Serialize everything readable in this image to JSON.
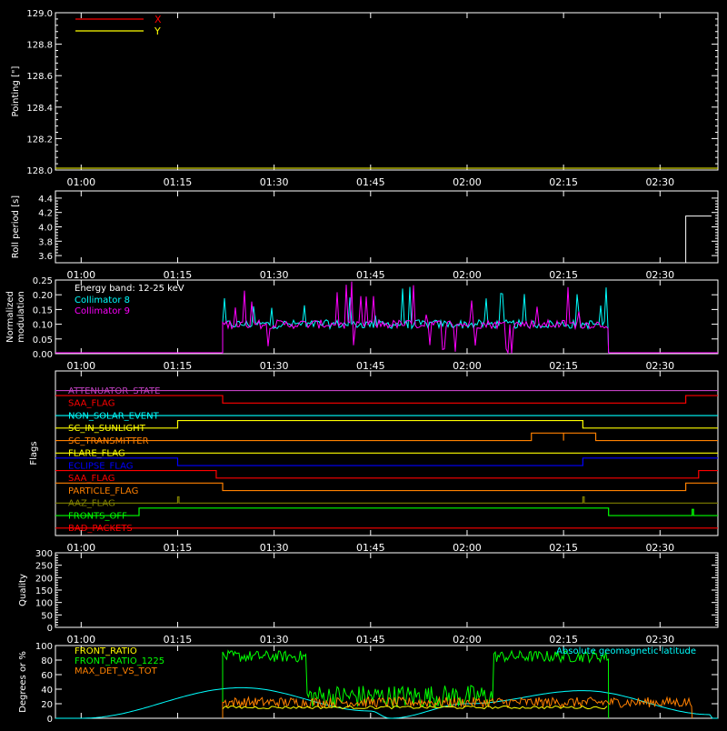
{
  "colors": {
    "background": "#000000",
    "axes": "#ffffff",
    "x": "#ff0000",
    "y": "#ffff00",
    "cyan": "#00ffff",
    "magenta": "#ff00ff",
    "green": "#00ff00",
    "orange": "#ff8000"
  },
  "time_ticks": [
    "01:00",
    "01:15",
    "01:30",
    "01:45",
    "02:00",
    "02:15",
    "02:30"
  ],
  "chart_data": [
    {
      "type": "line",
      "ylabel": "Pointing [\"]",
      "ylim": [
        128.0,
        129.0
      ],
      "yticks": [
        "128.0",
        "128.2",
        "128.4",
        "128.6",
        "128.8",
        "129.0"
      ],
      "legend_position": "top-left",
      "series": [
        {
          "name": "X",
          "color": "#ff0000",
          "x": [],
          "y": []
        },
        {
          "name": "Y",
          "color": "#ffff00",
          "x": [],
          "y": []
        }
      ]
    },
    {
      "type": "line",
      "ylabel": "Roll period [s]",
      "ylim": [
        3.5,
        4.5
      ],
      "yticks": [
        "3.6",
        "3.8",
        "4.0",
        "4.2",
        "4.4"
      ],
      "series": [
        {
          "x": [
            "02:34",
            "02:34",
            "02:38"
          ],
          "y": [
            3.5,
            4.15,
            4.15
          ]
        }
      ]
    },
    {
      "type": "line",
      "ylabel": "Normalized modulation",
      "ylim": [
        0.0,
        0.25
      ],
      "yticks": [
        "0.00",
        "0.05",
        "0.10",
        "0.15",
        "0.20",
        "0.25"
      ],
      "annotation": "Energy band: 12-25 keV",
      "legend_position": "top-left",
      "series": [
        {
          "name": "Collimator 8",
          "color": "#00ffff",
          "active_range": [
            "01:22",
            "02:22"
          ],
          "typical_value": 0.1,
          "peak_value": 0.23
        },
        {
          "name": "Collimator 9",
          "color": "#ff00ff",
          "active_range": [
            "01:22",
            "02:22"
          ],
          "typical_value": 0.1,
          "peak_value": 0.25
        }
      ]
    },
    {
      "type": "line",
      "ylabel": "Flags",
      "series": [
        {
          "name": "ATTENUATOR_STATE",
          "color": "#c040c0",
          "transitions": []
        },
        {
          "name": "SAA_FLAG_2",
          "label": "SAA_FLAG",
          "color": "#ff0000",
          "transitions": [
            [
              "01:00",
              1
            ],
            [
              "01:22",
              0
            ],
            [
              "02:34",
              1
            ]
          ]
        },
        {
          "name": "NON_SOLAR_EVENT",
          "color": "#00ffff",
          "transitions": []
        },
        {
          "name": "SC_IN_SUNLIGHT",
          "color": "#ffff00",
          "transitions": [
            [
              "01:00",
              0
            ],
            [
              "01:15",
              1
            ],
            [
              "02:18",
              0
            ]
          ]
        },
        {
          "name": "SC_TRANSMITTER",
          "color": "#ff8000",
          "transitions": [
            [
              "01:00",
              0
            ],
            [
              "02:10",
              1
            ],
            [
              "02:15",
              0
            ],
            [
              "02:15",
              1
            ],
            [
              "02:20",
              0
            ]
          ]
        },
        {
          "name": "FLARE_FLAG",
          "color": "#ffff00",
          "transitions": []
        },
        {
          "name": "ECLIPSE_FLAG",
          "color": "#0000ff",
          "transitions": [
            [
              "01:00",
              1
            ],
            [
              "01:15",
              0
            ],
            [
              "02:18",
              1
            ]
          ]
        },
        {
          "name": "SAA_FLAG",
          "color": "#ff0000",
          "transitions": [
            [
              "01:00",
              1
            ],
            [
              "01:21",
              0
            ],
            [
              "02:36",
              1
            ]
          ]
        },
        {
          "name": "PARTICLE_FLAG",
          "color": "#ff8000",
          "transitions": [
            [
              "01:00",
              1
            ],
            [
              "01:22",
              0
            ],
            [
              "02:34",
              1
            ]
          ]
        },
        {
          "name": "AAZ_FLAG",
          "color": "#808000",
          "transitions": [
            [
              "01:15",
              "spike"
            ],
            [
              "02:18",
              "spike"
            ]
          ]
        },
        {
          "name": "FRONTS_OFF",
          "color": "#00ff00",
          "transitions": [
            [
              "01:00",
              0
            ],
            [
              "01:09",
              1
            ],
            [
              "02:22",
              0
            ],
            [
              "02:35",
              "spike"
            ]
          ]
        },
        {
          "name": "BAD_PACKETS",
          "color": "#ff0000",
          "transitions": []
        }
      ]
    },
    {
      "type": "line",
      "ylabel": "Quality",
      "ylim": [
        0,
        300
      ],
      "yticks": [
        "0",
        "50",
        "100",
        "150",
        "200",
        "250",
        "300"
      ],
      "series": []
    },
    {
      "type": "line",
      "ylabel": "Degrees or %",
      "ylim": [
        0,
        100
      ],
      "yticks": [
        "0",
        "20",
        "40",
        "60",
        "80",
        "100"
      ],
      "legend_position": "top-left",
      "series": [
        {
          "name": "FRONT_RATIO",
          "color": "#ffff00",
          "typical_value": 15
        },
        {
          "name": "FRONT_RATIO_1225",
          "color": "#00ff00",
          "segments": [
            [
              "01:22",
              "01:35",
              85
            ],
            [
              "01:35",
              "02:04",
              30
            ],
            [
              "02:04",
              "02:22",
              85
            ]
          ]
        },
        {
          "name": "MAX_DET_VS_TOT",
          "color": "#ff8000",
          "active_range": [
            "01:22",
            "02:35"
          ],
          "typical_value": 22
        },
        {
          "name": "Absolute geomagnetic latitude",
          "color": "#00ffff",
          "points": [
            [
              "01:00",
              0
            ],
            [
              "01:25",
              42
            ],
            [
              "01:45",
              10
            ],
            [
              "01:48",
              0
            ],
            [
              "02:00",
              20
            ],
            [
              "02:18",
              38
            ],
            [
              "02:38",
              5
            ]
          ]
        }
      ]
    }
  ]
}
